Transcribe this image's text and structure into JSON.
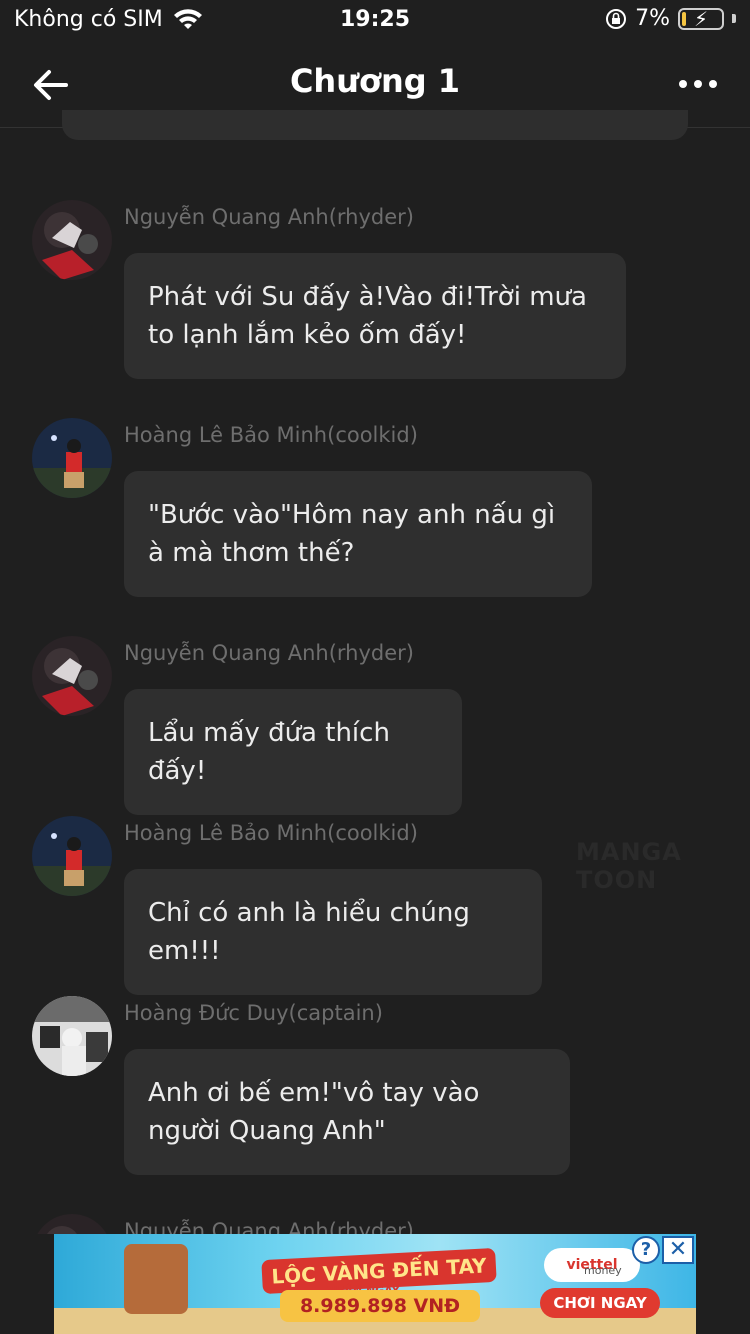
{
  "status_bar": {
    "carrier": "Không có SIM",
    "time": "19:25",
    "battery": "7%"
  },
  "nav": {
    "title": "Chương 1"
  },
  "messages": [
    {
      "sender": "Nguyễn Quang Anh(rhyder)",
      "text": "Phát với Su đấy à!Vào đi!Trời mưa to lạnh lắm kẻo ốm đấy!"
    },
    {
      "sender": "Hoàng Lê Bảo Minh(coolkid)",
      "text": "\"Bước vào\"Hôm nay anh nấu gì à mà thơm thế?"
    },
    {
      "sender": "Nguyễn Quang Anh(rhyder)",
      "text": "Lẩu mấy đứa thích đấy!"
    },
    {
      "sender": "Hoàng Lê Bảo Minh(coolkid)",
      "text": "Chỉ có anh là hiểu chúng em!!!"
    },
    {
      "sender": "Hoàng Đức Duy(captain)",
      "text": "Anh ơi bế em!\"vô tay vào người Quang Anh\""
    },
    {
      "sender": "Nguyễn Quang Anh(rhyder)"
    }
  ],
  "watermark": "MANGA TOON",
  "ad": {
    "headline": "LỘC VÀNG ĐẾN TAY",
    "sub": "NHẬN NGAY",
    "amount": "8.989.898 VNĐ",
    "brand": "viettel",
    "brand_sub": "money",
    "cta": "CHƠI NGAY",
    "info": "?",
    "close": "✕"
  },
  "colors": {
    "background": "#1f1f1f",
    "bubble": "#2f2f2f",
    "sender_text": "#6e6e6e"
  }
}
